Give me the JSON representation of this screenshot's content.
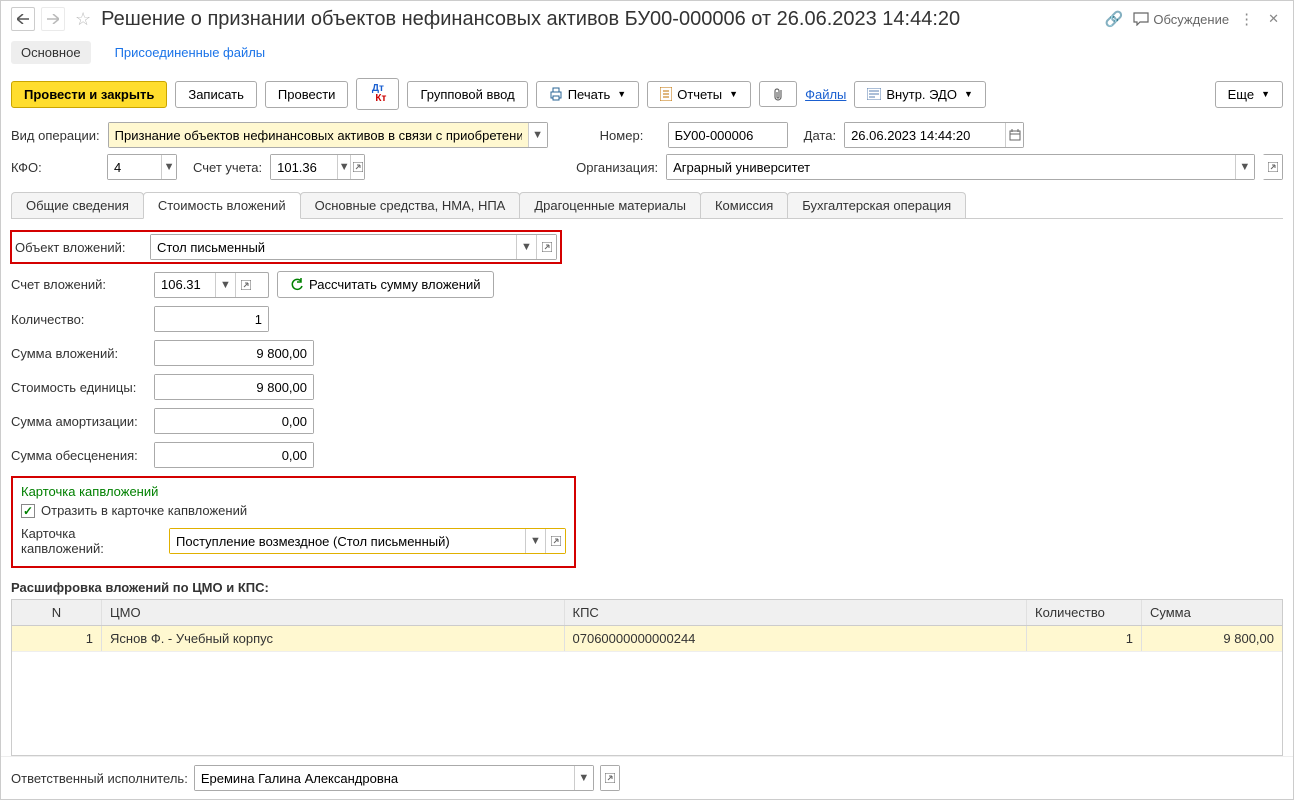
{
  "header": {
    "title": "Решение о признании объектов нефинансовых активов БУ00-000006 от 26.06.2023 14:44:20",
    "discuss": "Обсуждение"
  },
  "section_tabs": {
    "main": "Основное",
    "attached": "Присоединенные файлы"
  },
  "toolbar": {
    "post_close": "Провести и закрыть",
    "save": "Записать",
    "post": "Провести",
    "group_input": "Групповой ввод",
    "print": "Печать",
    "reports": "Отчеты",
    "files": "Файлы",
    "internal_edo": "Внутр. ЭДО",
    "more": "Еще"
  },
  "form": {
    "op_type_label": "Вид операции:",
    "op_type_value": "Признание объектов нефинансовых активов в связи с приобретением",
    "number_label": "Номер:",
    "number_value": "БУ00-000006",
    "date_label": "Дата:",
    "date_value": "26.06.2023 14:44:20",
    "kfo_label": "КФО:",
    "kfo_value": "4",
    "account_label": "Счет учета:",
    "account_value": "101.36",
    "org_label": "Организация:",
    "org_value": "Аграрный университет"
  },
  "tabs": {
    "general": "Общие сведения",
    "cost": "Стоимость вложений",
    "assets": "Основные средства, НМА, НПА",
    "precious": "Драгоценные материалы",
    "commission": "Комиссия",
    "accounting": "Бухгалтерская операция"
  },
  "cost_tab": {
    "object_label": "Объект вложений:",
    "object_value": "Стол письменный",
    "inv_account_label": "Счет вложений:",
    "inv_account_value": "106.31",
    "recalc": "Рассчитать сумму вложений",
    "qty_label": "Количество:",
    "qty_value": "1",
    "sum_label": "Сумма вложений:",
    "sum_value": "9 800,00",
    "unit_cost_label": "Стоимость единицы:",
    "unit_cost_value": "9 800,00",
    "amort_label": "Сумма амортизации:",
    "amort_value": "0,00",
    "impair_label": "Сумма обесценения:",
    "impair_value": "0,00",
    "kap_title": "Карточка капвложений",
    "kap_check": "Отразить в карточке капвложений",
    "kap_card_label": "Карточка капвложений:",
    "kap_card_value": "Поступление возмездное (Стол письменный)",
    "breakdown_title": "Расшифровка вложений по ЦМО и КПС:",
    "columns": {
      "n": "N",
      "cmo": "ЦМО",
      "kps": "КПС",
      "qty": "Количество",
      "sum": "Сумма"
    },
    "rows": [
      {
        "n": "1",
        "cmo": "Яснов Ф. - Учебный корпус",
        "kps": "07060000000000244",
        "qty": "1",
        "sum": "9 800,00"
      }
    ]
  },
  "footer": {
    "responsible_label": "Ответственный исполнитель:",
    "responsible_value": "Еремина Галина Александровна"
  }
}
